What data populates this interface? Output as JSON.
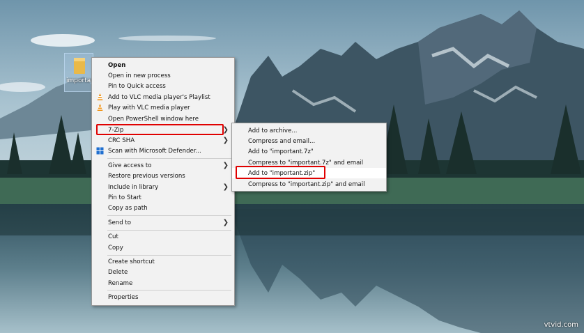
{
  "desktop": {
    "icon_label": "importan"
  },
  "context_menu": {
    "items": [
      {
        "label": "Open"
      },
      {
        "label": "Open in new process"
      },
      {
        "label": "Pin to Quick access"
      },
      {
        "label": "Add to VLC media player's Playlist",
        "icon": "vlc-cone-icon"
      },
      {
        "label": "Play with VLC media player",
        "icon": "vlc-cone-icon"
      },
      {
        "label": "Open PowerShell window here"
      },
      {
        "label": "7-Zip"
      },
      {
        "label": "CRC SHA"
      },
      {
        "label": "Scan with Microsoft Defender...",
        "icon": "defender-shield-icon"
      },
      {
        "label": "Give access to"
      },
      {
        "label": "Restore previous versions"
      },
      {
        "label": "Include in library"
      },
      {
        "label": "Pin to Start"
      },
      {
        "label": "Copy as path"
      },
      {
        "label": "Send to"
      },
      {
        "label": "Cut"
      },
      {
        "label": "Copy"
      },
      {
        "label": "Create shortcut"
      },
      {
        "label": "Delete"
      },
      {
        "label": "Rename"
      },
      {
        "label": "Properties"
      }
    ]
  },
  "zip_submenu": {
    "items": [
      {
        "label": "Add to archive..."
      },
      {
        "label": "Compress and email..."
      },
      {
        "label": "Add to \"important.7z\""
      },
      {
        "label": "Compress to \"important.7z\" and email"
      },
      {
        "label": "Add to \"important.zip\""
      },
      {
        "label": "Compress to \"important.zip\" and email"
      }
    ]
  },
  "watermark": "vtvid.com",
  "colors": {
    "menu_background": "#f2f2f2",
    "highlight_box": "#e00000",
    "vlc_orange": "#f08a00",
    "defender_blue": "#1f6fd0"
  }
}
